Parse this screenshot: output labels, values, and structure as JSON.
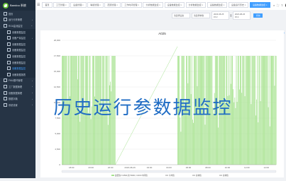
{
  "app": {
    "name": "Bandou 系统"
  },
  "sidebar": {
    "items": [
      {
        "label": "首页",
        "sub": false,
        "active": false,
        "arrow": ""
      },
      {
        "label": "运行分析管理",
        "sub": false,
        "active": false,
        "arrow": "›"
      },
      {
        "label": "ROA监测监控",
        "sub": false,
        "active": false,
        "arrow": "⌄"
      },
      {
        "label": "设备数据监控",
        "sub": true,
        "active": false,
        "arrow": ""
      },
      {
        "label": "设备产量监控",
        "sub": true,
        "active": false,
        "arrow": "›"
      },
      {
        "label": "设备数据监控",
        "sub": true,
        "active": false,
        "arrow": ""
      },
      {
        "label": "设备数据监控",
        "sub": true,
        "active": false,
        "arrow": ""
      },
      {
        "label": "设备数据监控",
        "sub": true,
        "active": false,
        "arrow": ""
      },
      {
        "label": "设备数据监控",
        "sub": true,
        "active": false,
        "arrow": ""
      },
      {
        "label": "设备数据监控",
        "sub": true,
        "active": true,
        "arrow": ""
      },
      {
        "label": "设备数据报表",
        "sub": true,
        "active": false,
        "arrow": ""
      },
      {
        "label": "FMU循环管理",
        "sub": false,
        "active": false,
        "arrow": "›"
      },
      {
        "label": "工厂数据管理",
        "sub": false,
        "active": false,
        "arrow": "›"
      },
      {
        "label": "设备数据管理",
        "sub": false,
        "active": false,
        "arrow": "›"
      },
      {
        "label": "数据字典",
        "sub": false,
        "active": false,
        "arrow": "›"
      },
      {
        "label": "系统设置",
        "sub": false,
        "active": false,
        "arrow": "›"
      }
    ]
  },
  "tabs": [
    {
      "label": "首页",
      "active": false
    },
    {
      "label": "工艺管理 ×",
      "active": false
    },
    {
      "label": "设备管理 ×",
      "active": false
    },
    {
      "label": "等级管理 ×",
      "active": false
    },
    {
      "label": "范围管理 ×",
      "active": false
    },
    {
      "label": "工作时间管理 ×",
      "active": false
    },
    {
      "label": "分析数据监控 ×",
      "active": false
    },
    {
      "label": "设备数据监控 ×",
      "active": false
    },
    {
      "label": "分析数据监控 ×",
      "active": false
    },
    {
      "label": "设备数据监控 ×",
      "active": false
    },
    {
      "label": "设备运行历史 ×",
      "active": false
    },
    {
      "label": "设备数据监控 ×",
      "active": true
    }
  ],
  "filters": {
    "device_placeholder": "请选择设备",
    "param_placeholder": "请选择参数",
    "start_date": "2023-08-25 15:2",
    "separator": "至",
    "end_date": "2023-08-26 15:2",
    "search_label": "查询"
  },
  "overlay_title": "历史运行参数据监控",
  "colors": {
    "series": "#a6e28f",
    "accent": "#409eff",
    "sidebar": "#263445"
  },
  "chart_data": {
    "type": "area",
    "title": "A025",
    "ylim": [
      0,
      20000
    ],
    "yticks": [
      "0",
      "2,500",
      "5,000",
      "7,500",
      "10,000",
      "12,500",
      "15,000",
      "17,500",
      "20,000"
    ],
    "xticks": [
      "18:00",
      "20:00",
      "22:00",
      "2023-08-26",
      "02:00",
      "04:00",
      "06:00",
      "08:00",
      "10:00",
      "12:00",
      "14:00"
    ],
    "grid": true,
    "legend_position": "bottom",
    "legend": [
      "最低值/<=2500,次<5000,>=2000",
      "中间值",
      "平均值",
      "总体值",
      "总体值"
    ],
    "series": [
      {
        "name": "最低值/<=2500,次<5000,>=2000",
        "segments": [
          [
            0.0,
            0.25
          ],
          [
            0.54,
            1.0
          ]
        ],
        "low": 0,
        "high": 17500
      }
    ]
  }
}
